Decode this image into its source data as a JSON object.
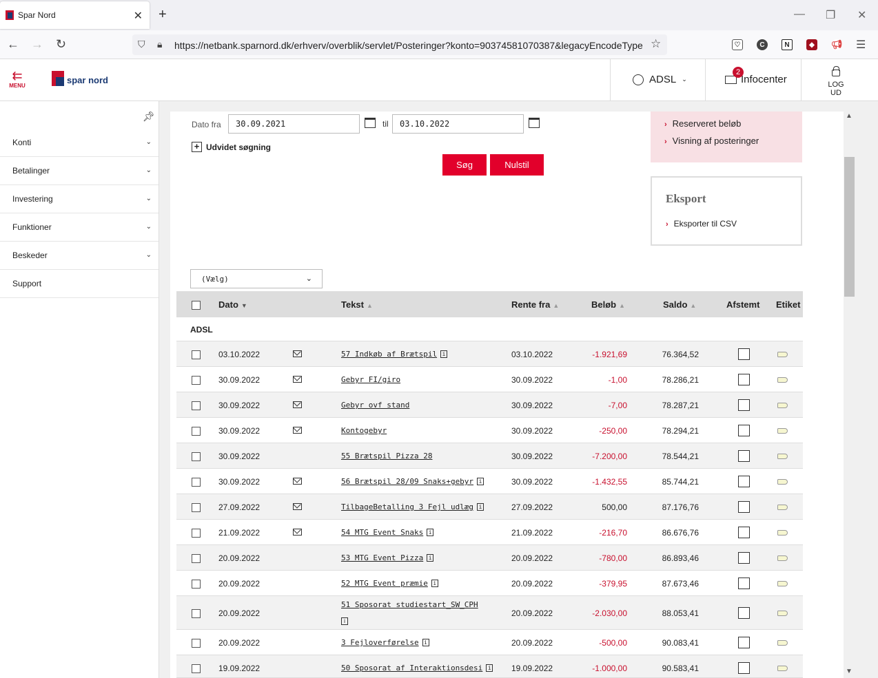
{
  "browser": {
    "tab_title": "Spar Nord",
    "url": "https://netbank.sparnord.dk/erhverv/overblik/servlet/Posteringer?konto=90374581070387&legacyEncodeType="
  },
  "header": {
    "menu_label": "MENU",
    "logo_text": "spar nord",
    "user_label": "ADSL",
    "info_label": "Infocenter",
    "info_badge": "2",
    "logout_label": "LOG UD"
  },
  "sidebar": {
    "items": [
      {
        "label": "Konti",
        "expandable": true
      },
      {
        "label": "Betalinger",
        "expandable": true
      },
      {
        "label": "Investering",
        "expandable": true
      },
      {
        "label": "Funktioner",
        "expandable": true
      },
      {
        "label": "Beskeder",
        "expandable": true
      },
      {
        "label": "Support",
        "expandable": false
      }
    ]
  },
  "search": {
    "date_from_label": "Dato fra",
    "date_from": "30.09.2021",
    "til_label": "til",
    "date_to": "03.10.2022",
    "advanced_label": "Udvidet søgning",
    "search_button": "Søg",
    "reset_button": "Nulstil"
  },
  "side_panel": {
    "links": [
      "Reserveret beløb",
      "Visning af posteringer"
    ],
    "export_title": "Eksport",
    "export_link": "Eksporter til CSV"
  },
  "filter": {
    "selected": "(Vælg)"
  },
  "table": {
    "headers": {
      "dato": "Dato",
      "tekst": "Tekst",
      "rente_fra": "Rente fra",
      "beloeb": "Beløb",
      "saldo": "Saldo",
      "afstemt": "Afstemt",
      "etiket": "Etiket"
    },
    "group": "ADSL",
    "rows": [
      {
        "dato": "03.10.2022",
        "mail": true,
        "tekst": "57 Indkøb af Brætspil",
        "info": true,
        "rente": "03.10.2022",
        "beloeb": "-1.921,69",
        "saldo": "76.364,52"
      },
      {
        "dato": "30.09.2022",
        "mail": true,
        "tekst": "Gebyr FI/giro",
        "info": false,
        "rente": "30.09.2022",
        "beloeb": "-1,00",
        "saldo": "78.286,21"
      },
      {
        "dato": "30.09.2022",
        "mail": true,
        "tekst": "Gebyr ovf stand",
        "info": false,
        "rente": "30.09.2022",
        "beloeb": "-7,00",
        "saldo": "78.287,21"
      },
      {
        "dato": "30.09.2022",
        "mail": true,
        "tekst": "Kontogebyr",
        "info": false,
        "rente": "30.09.2022",
        "beloeb": "-250,00",
        "saldo": "78.294,21"
      },
      {
        "dato": "30.09.2022",
        "mail": false,
        "tekst": "55 Brætspil Pizza 28",
        "info": false,
        "rente": "30.09.2022",
        "beloeb": "-7.200,00",
        "saldo": "78.544,21"
      },
      {
        "dato": "30.09.2022",
        "mail": true,
        "tekst": "56 Brætspil 28/09 Snaks+gebyr",
        "info": true,
        "rente": "30.09.2022",
        "beloeb": "-1.432,55",
        "saldo": "85.744,21"
      },
      {
        "dato": "27.09.2022",
        "mail": true,
        "tekst": "TilbageBetalling 3 Fejl udlæg",
        "info": true,
        "rente": "27.09.2022",
        "beloeb": "500,00",
        "saldo": "87.176,76"
      },
      {
        "dato": "21.09.2022",
        "mail": true,
        "tekst": "54 MTG Event Snaks",
        "info": true,
        "rente": "21.09.2022",
        "beloeb": "-216,70",
        "saldo": "86.676,76"
      },
      {
        "dato": "20.09.2022",
        "mail": false,
        "tekst": "53 MTG Event Pizza",
        "info": true,
        "rente": "20.09.2022",
        "beloeb": "-780,00",
        "saldo": "86.893,46"
      },
      {
        "dato": "20.09.2022",
        "mail": false,
        "tekst": "52 MTG Event præmie",
        "info": true,
        "rente": "20.09.2022",
        "beloeb": "-379,95",
        "saldo": "87.673,46"
      },
      {
        "dato": "20.09.2022",
        "mail": false,
        "tekst": "51 Sposorat studiestart_SW_CPH",
        "info": true,
        "info_wrap": true,
        "rente": "20.09.2022",
        "beloeb": "-2.030,00",
        "saldo": "88.053,41"
      },
      {
        "dato": "20.09.2022",
        "mail": false,
        "tekst": "3 Fejloverførelse",
        "info": true,
        "rente": "20.09.2022",
        "beloeb": "-500,00",
        "saldo": "90.083,41"
      },
      {
        "dato": "19.09.2022",
        "mail": false,
        "tekst": "50 Sposorat af Interaktionsdesi",
        "info": true,
        "rente": "19.09.2022",
        "beloeb": "-1.000,00",
        "saldo": "90.583,41"
      }
    ]
  },
  "colors": {
    "brand_red": "#c8102e",
    "brand_blue": "#1b3a73",
    "button_red": "#e2002b",
    "negative": "#c8102e"
  }
}
